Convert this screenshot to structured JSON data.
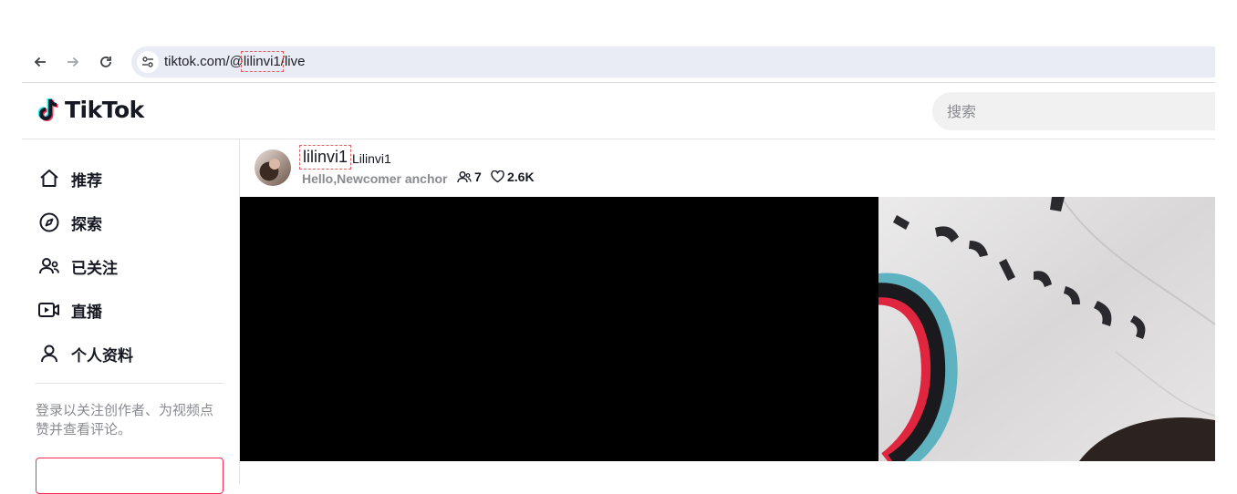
{
  "browser": {
    "url_prefix": "tiktok.com/@",
    "url_user": "lilinvi1",
    "url_suffix": "/live",
    "back_icon": "arrow-left-icon",
    "forward_icon": "arrow-right-icon",
    "reload_icon": "reload-icon"
  },
  "header": {
    "logo_text": "TikTok",
    "search_placeholder": "搜索"
  },
  "sidebar": {
    "items": [
      {
        "label": "推荐",
        "icon": "home-icon"
      },
      {
        "label": "探索",
        "icon": "compass-icon"
      },
      {
        "label": "已关注",
        "icon": "following-icon"
      },
      {
        "label": "直播",
        "icon": "live-icon"
      },
      {
        "label": "个人资料",
        "icon": "profile-icon"
      }
    ],
    "login_hint": "登录以关注创作者、为视频点赞并查看评论。"
  },
  "live": {
    "anchor_name": "lilinvi1",
    "anchor_nickname": "Lilinvi1",
    "bio": "Hello,Newcomer anchor",
    "viewers": "7",
    "likes": "2.6K"
  },
  "colors": {
    "brand_red": "#fe2c55",
    "brand_cyan": "#25f4ee",
    "omnibox_bg": "#e9ecf5"
  }
}
